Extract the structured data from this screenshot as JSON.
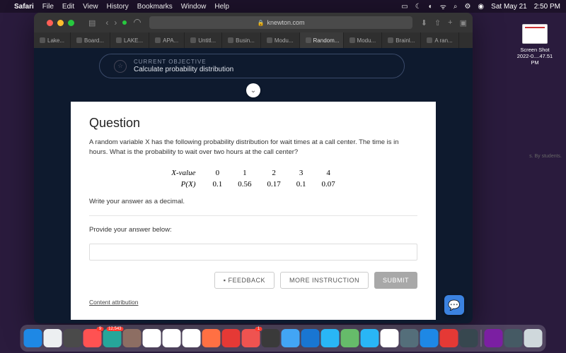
{
  "menubar": {
    "app": "Safari",
    "items": [
      "File",
      "Edit",
      "View",
      "History",
      "Bookmarks",
      "Window",
      "Help"
    ],
    "date": "Sat May 21",
    "time": "2:50 PM"
  },
  "url": "knewton.com",
  "tabs": [
    {
      "label": "Lake...",
      "active": false
    },
    {
      "label": "Board...",
      "active": false
    },
    {
      "label": "LAKE...",
      "active": false
    },
    {
      "label": "APA...",
      "active": false
    },
    {
      "label": "Untitl...",
      "active": false
    },
    {
      "label": "Busin...",
      "active": false
    },
    {
      "label": "Modu...",
      "active": false
    },
    {
      "label": "Random...",
      "active": true
    },
    {
      "label": "Modu...",
      "active": false
    },
    {
      "label": "Brainl...",
      "active": false
    },
    {
      "label": "A ran...",
      "active": false
    }
  ],
  "objective": {
    "eyebrow": "CURRENT OBJECTIVE",
    "title": "Calculate probability distribution"
  },
  "question": {
    "heading": "Question",
    "body": "A random variable X has the following probability distribution for wait times at a call center. The time is in hours. What is the probability to wait over two hours at the call center?",
    "row1_label": "X-value",
    "row2_label": "P(X)",
    "instruction": "Write your answer as a decimal.",
    "provide": "Provide your answer below:"
  },
  "chart_data": {
    "type": "table",
    "x_values": [
      0,
      1,
      2,
      3,
      4
    ],
    "p_values": [
      0.1,
      0.56,
      0.17,
      0.1,
      0.07
    ]
  },
  "buttons": {
    "feedback": "FEEDBACK",
    "more": "MORE INSTRUCTION",
    "submit": "SUBMIT"
  },
  "attribution": "Content attribution",
  "desktop_file": {
    "line1": "Screen Shot",
    "line2": "2022-0....47.51 PM"
  },
  "dock_colors": [
    "#1e88e5",
    "#eceff1",
    "#4a4a4a",
    "#ff5252",
    "#26a69a",
    "#8d6e63",
    "#ffffff",
    "#ffffff",
    "#ffffff",
    "#ff7043",
    "#e53935",
    "#ef5350",
    "#3a3a3a",
    "#42a5f5",
    "#1976d2",
    "#29b6f6",
    "#66bb6a",
    "#29b6f6",
    "#ffffff",
    "#546e7a",
    "#1e88e5",
    "#e53935",
    "#37474f",
    "#7b1fa2",
    "#455a64",
    "#cfd8dc"
  ],
  "badges": {
    "3": "9",
    "4": "12,543",
    "11": "1"
  }
}
